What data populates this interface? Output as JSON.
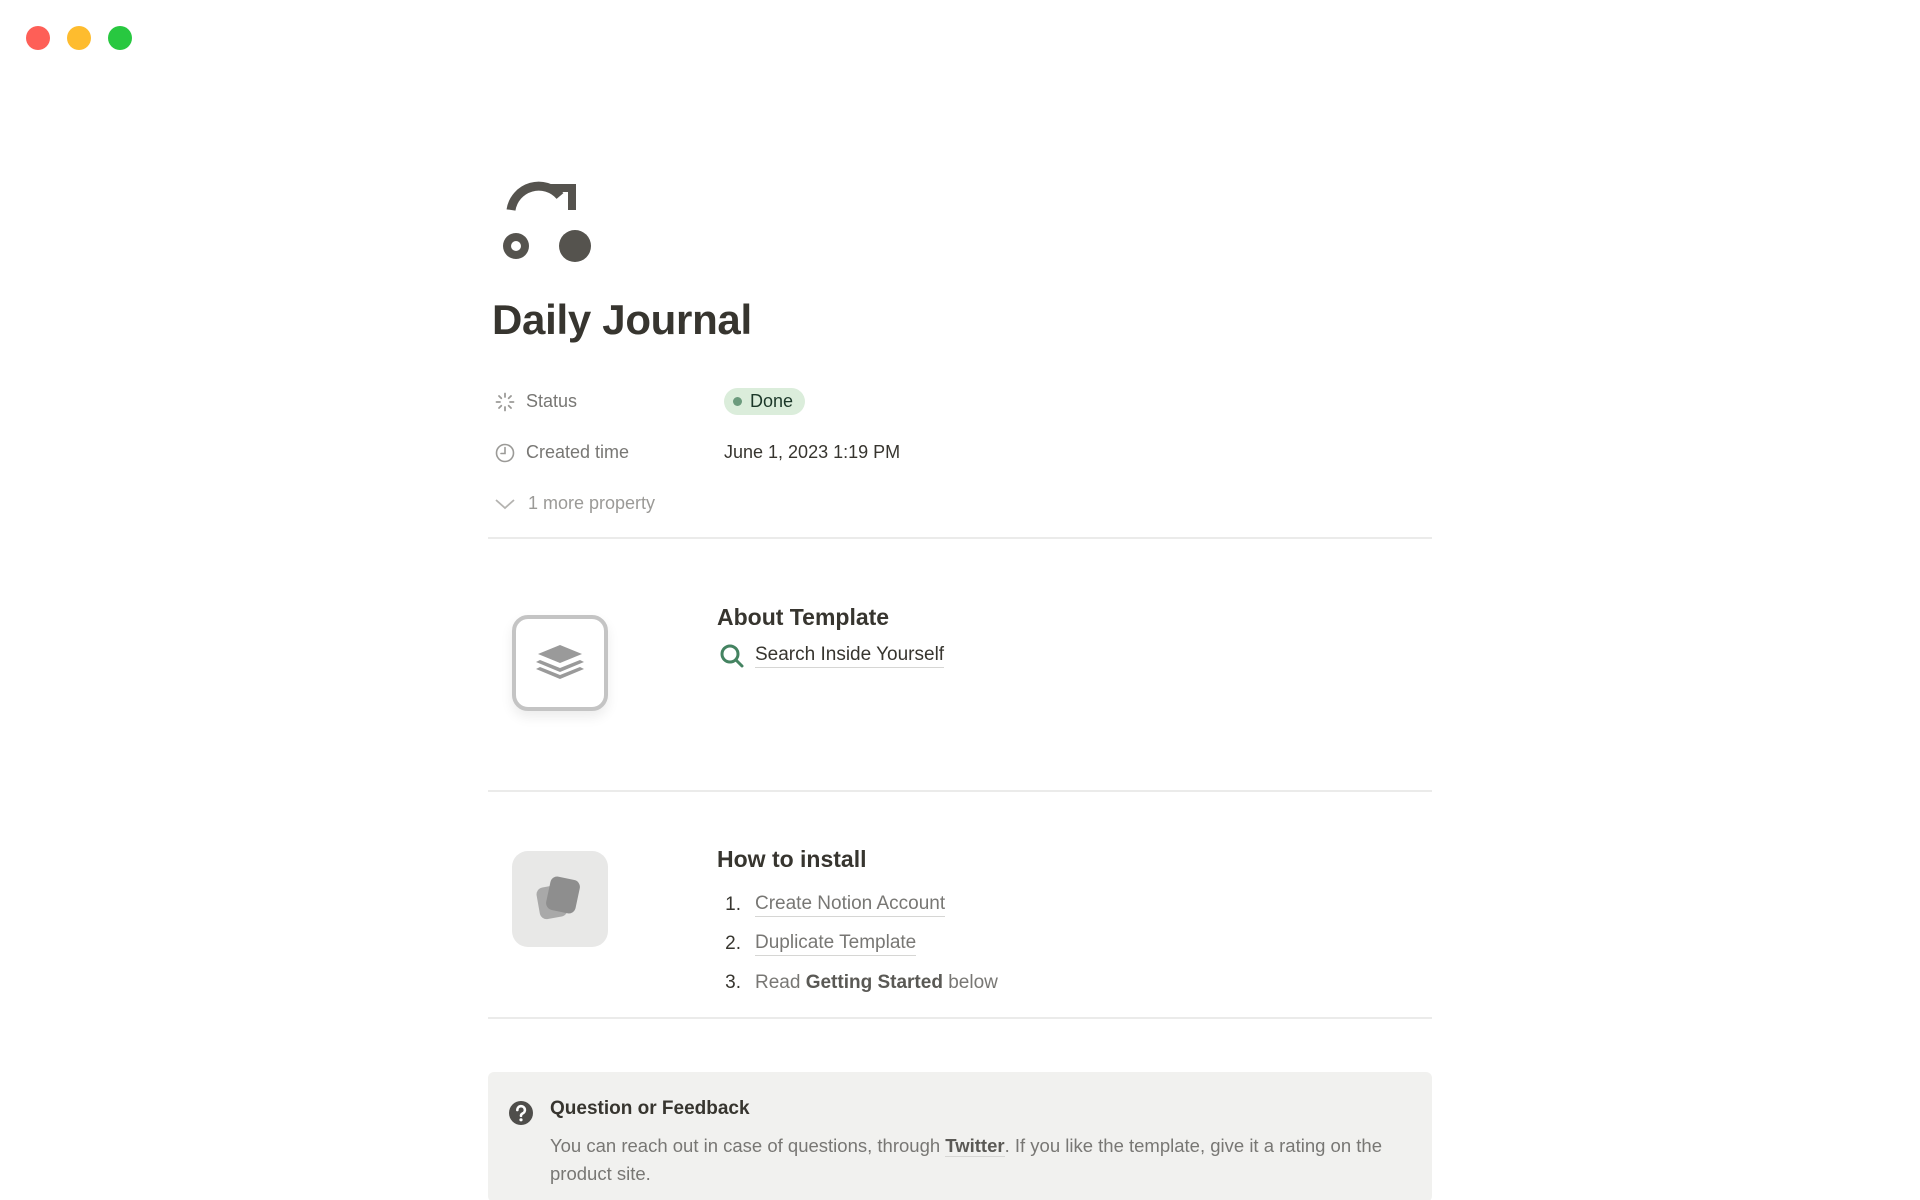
{
  "window": {
    "controls": [
      "close",
      "minimize",
      "maximize"
    ]
  },
  "page": {
    "icon": "route-arrow-icon",
    "title": "Daily Journal"
  },
  "properties": [
    {
      "icon": "status-spinner-icon",
      "name": "Status",
      "value": "Done",
      "type": "status",
      "color": "#dbeddb"
    },
    {
      "icon": "clock-icon",
      "name": "Created time",
      "value": "June 1, 2023 1:19 PM",
      "type": "created_time"
    }
  ],
  "more_properties": {
    "icon": "chevron-down-icon",
    "label": "1 more property"
  },
  "about": {
    "icon": "layers-icon",
    "title": "About Template",
    "link_icon": "search-icon",
    "link_label": "Search Inside Yourself"
  },
  "install": {
    "icon": "cards-icon",
    "title": "How to install",
    "steps": [
      {
        "num": "1.",
        "text": "Create Notion Account"
      },
      {
        "num": "2.",
        "text": "Duplicate Template"
      },
      {
        "num": "3.",
        "pre": "Read ",
        "bold": "Getting Started",
        "post": " below"
      }
    ]
  },
  "callout": {
    "icon": "question-circle-icon",
    "title": "Question or Feedback",
    "text_before": "You can reach out in case of questions, through ",
    "link": "Twitter",
    "text_after": ". If you like the template, give it a rating on the product site."
  }
}
